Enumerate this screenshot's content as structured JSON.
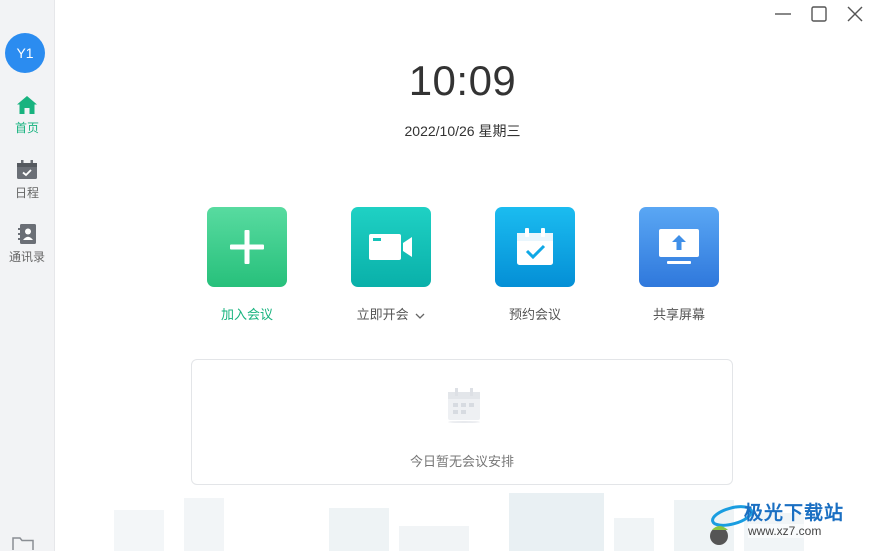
{
  "user": {
    "avatar_text": "Y1"
  },
  "sidebar": {
    "items": [
      {
        "label": "首页",
        "icon": "home-icon",
        "active": true
      },
      {
        "label": "日程",
        "icon": "calendar-icon",
        "active": false
      },
      {
        "label": "通讯录",
        "icon": "contacts-icon",
        "active": false
      }
    ],
    "bottom_icon": "folder-icon"
  },
  "window_controls": [
    "minimize-icon",
    "maximize-icon",
    "close-icon"
  ],
  "clock": {
    "time": "10:09",
    "date": "2022/10/26 星期三"
  },
  "actions": [
    {
      "label": "加入会议",
      "icon": "plus-icon",
      "color": "#3ecf8e"
    },
    {
      "label": "立即开会",
      "icon": "video-camera-icon",
      "color": "#14c2b8",
      "has_dropdown": true
    },
    {
      "label": "预约会议",
      "icon": "calendar-check-icon",
      "color": "#0fa8e6"
    },
    {
      "label": "共享屏幕",
      "icon": "share-screen-icon",
      "color": "#3f8fe8"
    }
  ],
  "schedule": {
    "empty_text": "今日暂无会议安排"
  },
  "watermark": {
    "title": "极光下载站",
    "url": "www.xz7.com"
  },
  "colors": {
    "accent": "#18b37f",
    "avatar": "#2b8cf0"
  }
}
